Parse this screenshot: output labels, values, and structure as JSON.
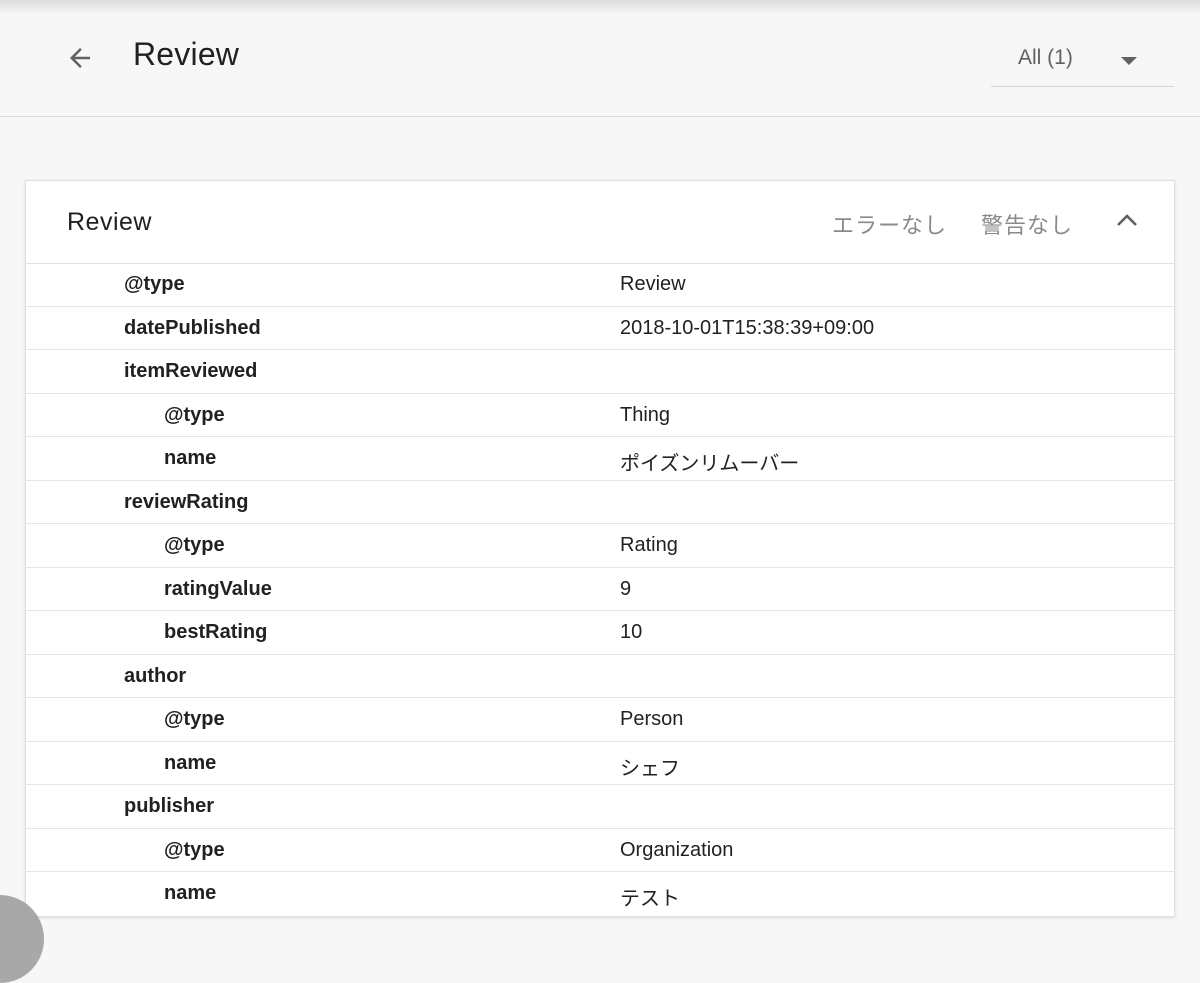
{
  "header": {
    "title": "Review",
    "back_icon": "arrow-back-icon",
    "filter": {
      "label": "All (1)",
      "icon": "caret-down-icon"
    }
  },
  "card": {
    "title": "Review",
    "errors": "エラーなし",
    "warnings": "警告なし",
    "collapse_icon": "chevron-up-icon",
    "rows": [
      {
        "key": "@type",
        "value": "Review",
        "level": 0
      },
      {
        "key": "datePublished",
        "value": "2018-10-01T15:38:39+09:00",
        "level": 0
      },
      {
        "key": "itemReviewed",
        "value": "",
        "level": 0
      },
      {
        "key": "@type",
        "value": "Thing",
        "level": 1
      },
      {
        "key": "name",
        "value": "ポイズンリムーバー",
        "level": 1
      },
      {
        "key": "reviewRating",
        "value": "",
        "level": 0
      },
      {
        "key": "@type",
        "value": "Rating",
        "level": 1
      },
      {
        "key": "ratingValue",
        "value": "9",
        "level": 1
      },
      {
        "key": "bestRating",
        "value": "10",
        "level": 1
      },
      {
        "key": "author",
        "value": "",
        "level": 0
      },
      {
        "key": "@type",
        "value": "Person",
        "level": 1
      },
      {
        "key": "name",
        "value": "シェフ",
        "level": 1
      },
      {
        "key": "publisher",
        "value": "",
        "level": 0
      },
      {
        "key": "@type",
        "value": "Organization",
        "level": 1
      },
      {
        "key": "name",
        "value": "テスト",
        "level": 1
      }
    ]
  }
}
